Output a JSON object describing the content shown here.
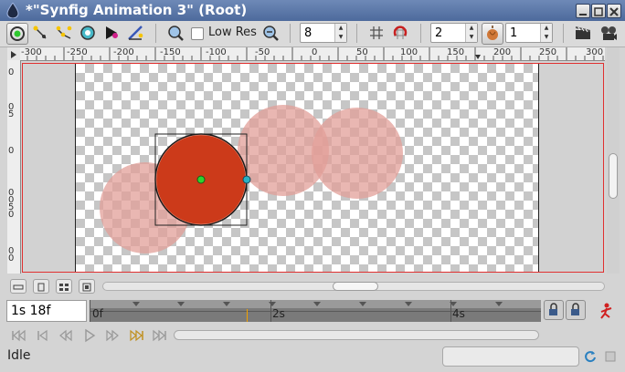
{
  "window": {
    "title": "*\"Synfig Animation 3\" (Root)"
  },
  "toolbar": {
    "lowres_label": "Low Res",
    "lowres_checked": false,
    "grid_value": "8",
    "onion_past": "2",
    "onion_future": "1",
    "icons": [
      "transform-tool-icon",
      "smooth-move-icon",
      "scale-tool-icon",
      "rotate-tool-icon",
      "mirror-tool-icon",
      "draw-tool-icon",
      "zoom-in-icon",
      "zoom-out-icon",
      "grid-icon",
      "snap-icon",
      "onion-skin-icon",
      "render-icon",
      "preview-icon"
    ]
  },
  "ruler_top": {
    "labels": [
      "-300",
      "-250",
      "-200",
      "-150",
      "-100",
      "-50",
      "0",
      "50",
      "100",
      "150",
      "200",
      "250",
      "300"
    ]
  },
  "ruler_left": {
    "labels": [
      "0",
      "0",
      "5",
      "0",
      "0",
      "0",
      "5",
      "0",
      "0",
      "0"
    ]
  },
  "canvas": {
    "accent_color": "#cc3a1a",
    "faded_color": "#e8a09a"
  },
  "time": {
    "current": "1s 18f",
    "labels": [
      "0f",
      "2s",
      "4s"
    ]
  },
  "status": {
    "text": "Idle",
    "field_value": ""
  }
}
